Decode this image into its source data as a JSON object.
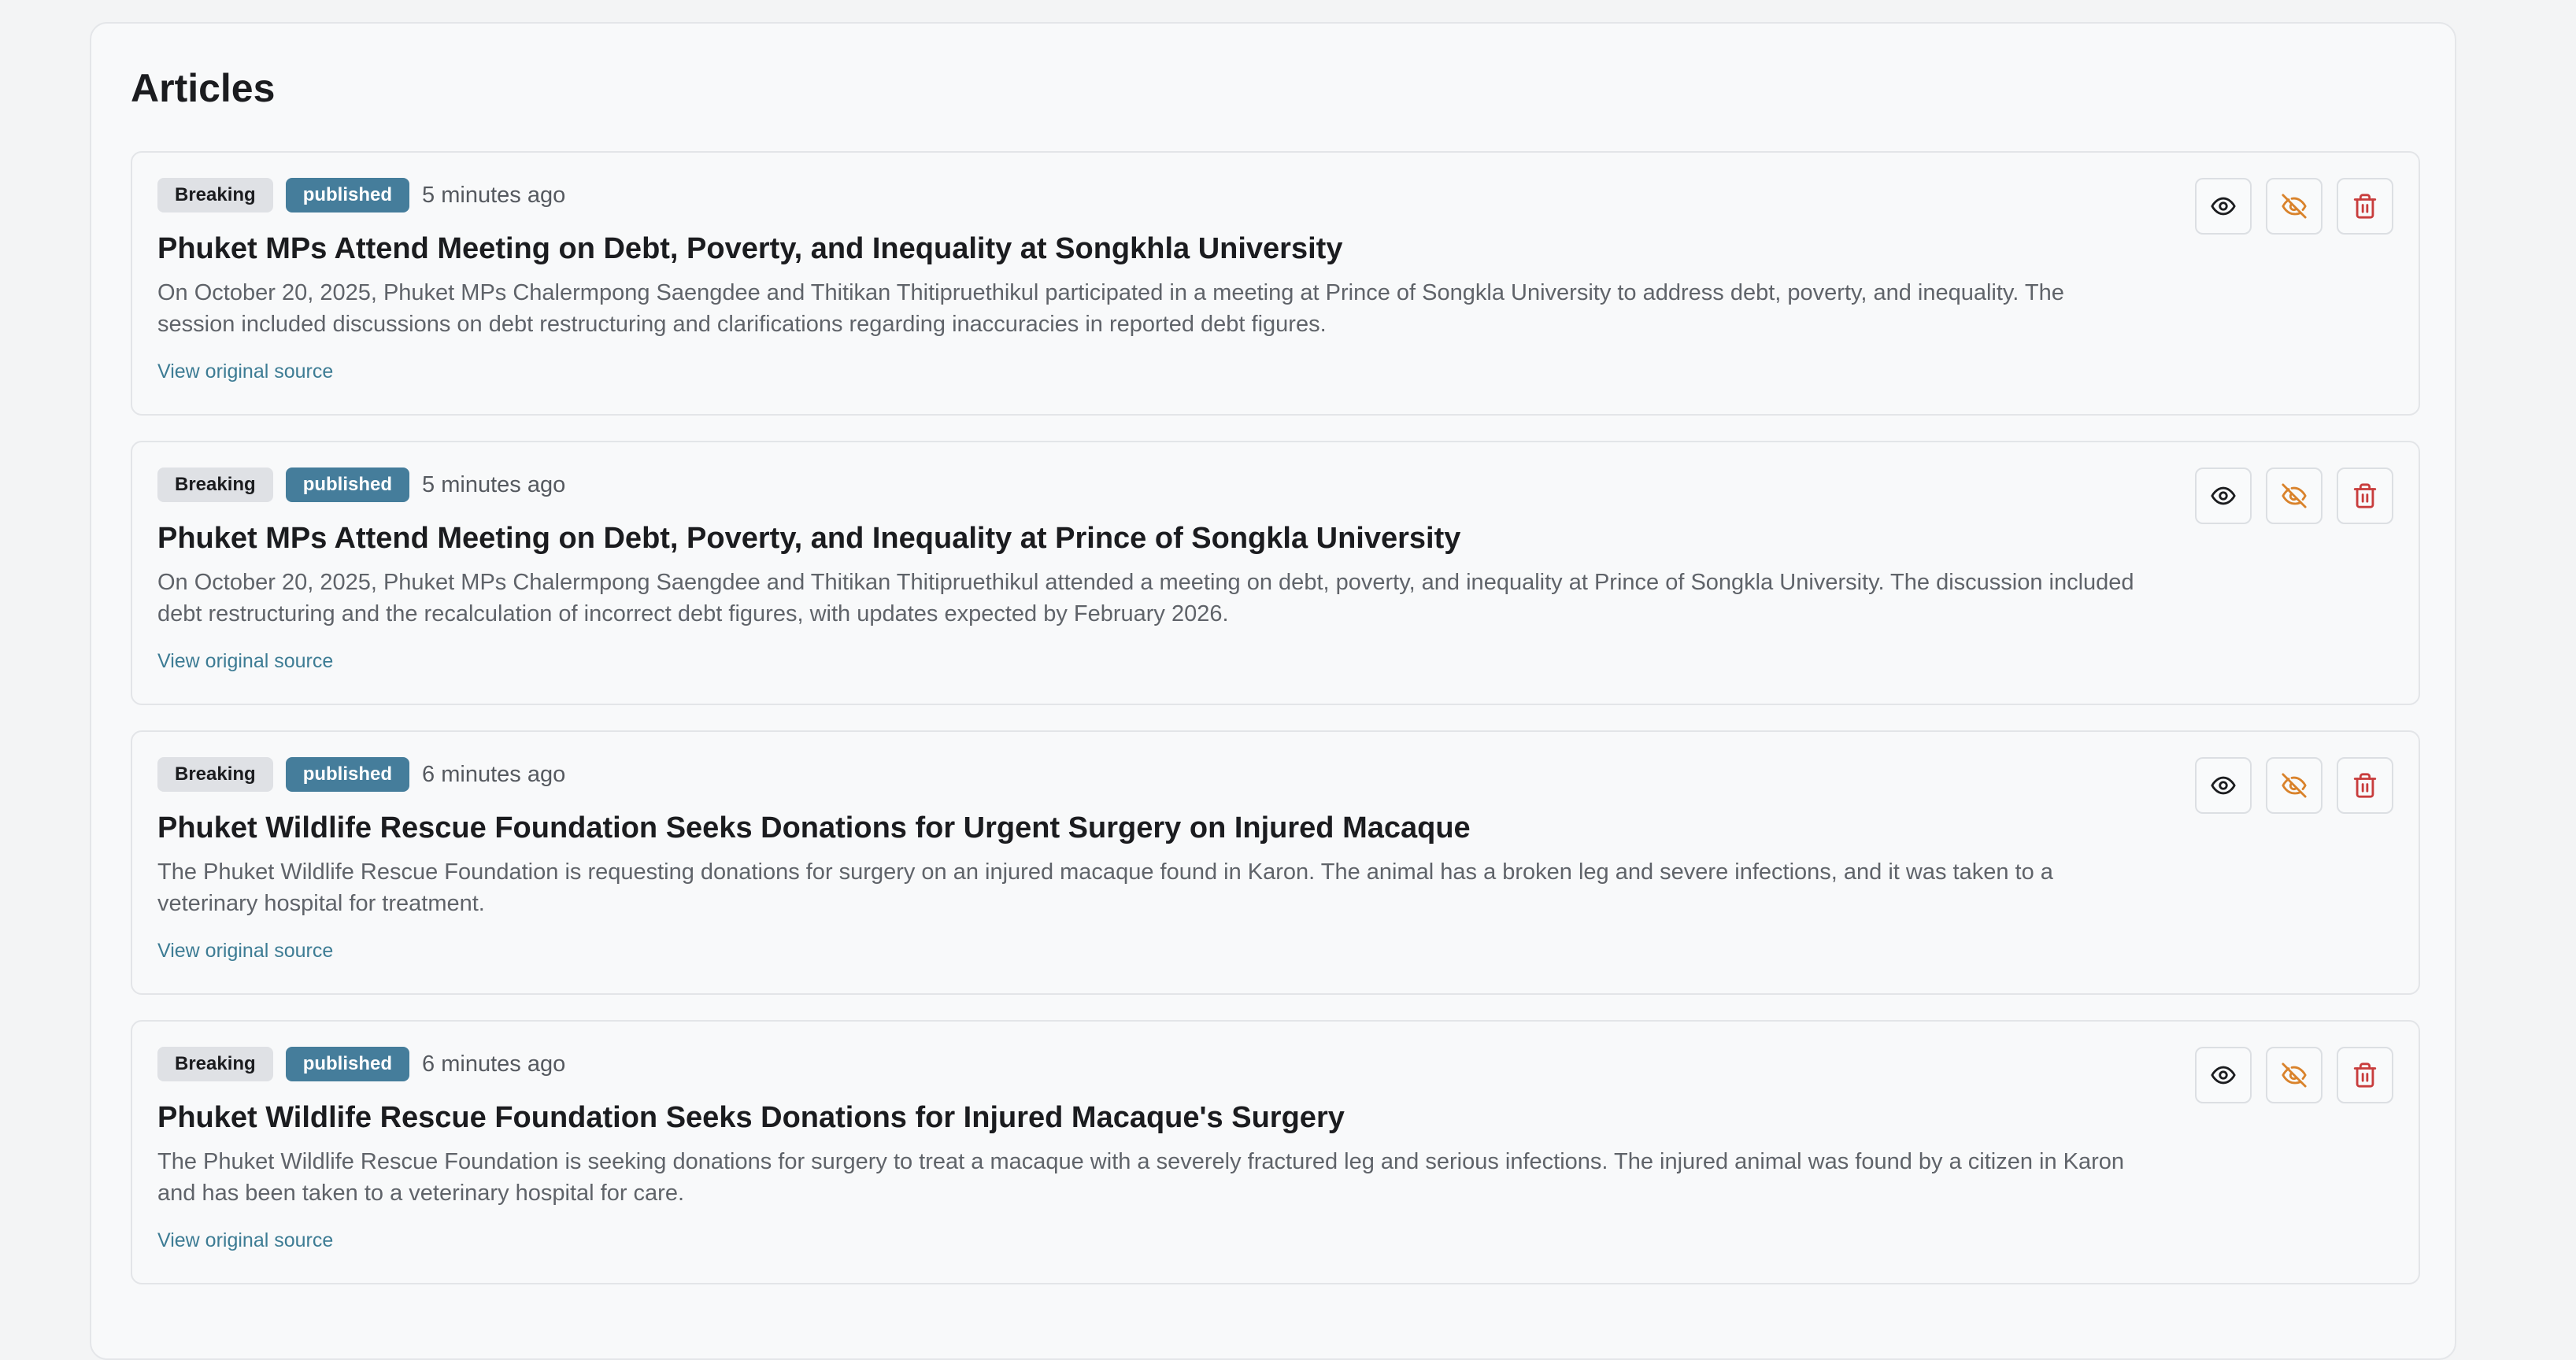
{
  "page": {
    "title": "Articles"
  },
  "colors": {
    "status_published": "#457d9b",
    "hide_action": "#d9822b",
    "delete_action": "#c83c3c",
    "link": "#3d7c94"
  },
  "actions": {
    "view_icon": "eye-icon",
    "hide_icon": "eye-off-icon",
    "delete_icon": "trash-icon"
  },
  "articles": [
    {
      "category": "Breaking",
      "status": "published",
      "time": "5 minutes ago",
      "title": "Phuket MPs Attend Meeting on Debt, Poverty, and Inequality at Songkhla University",
      "summary": "On October 20, 2025, Phuket MPs Chalermpong Saengdee and Thitikan Thitipruethikul participated in a meeting at Prince of Songkla University to address debt, poverty, and inequality. The session included discussions on debt restructuring and clarifications regarding inaccuracies in reported debt figures.",
      "link_text": "View original source"
    },
    {
      "category": "Breaking",
      "status": "published",
      "time": "5 minutes ago",
      "title": "Phuket MPs Attend Meeting on Debt, Poverty, and Inequality at Prince of Songkla University",
      "summary": "On October 20, 2025, Phuket MPs Chalermpong Saengdee and Thitikan Thitipruethikul attended a meeting on debt, poverty, and inequality at Prince of Songkla University. The discussion included debt restructuring and the recalculation of incorrect debt figures, with updates expected by February 2026.",
      "link_text": "View original source"
    },
    {
      "category": "Breaking",
      "status": "published",
      "time": "6 minutes ago",
      "title": "Phuket Wildlife Rescue Foundation Seeks Donations for Urgent Surgery on Injured Macaque",
      "summary": "The Phuket Wildlife Rescue Foundation is requesting donations for surgery on an injured macaque found in Karon. The animal has a broken leg and severe infections, and it was taken to a veterinary hospital for treatment.",
      "link_text": "View original source"
    },
    {
      "category": "Breaking",
      "status": "published",
      "time": "6 minutes ago",
      "title": "Phuket Wildlife Rescue Foundation Seeks Donations for Injured Macaque's Surgery",
      "summary": "The Phuket Wildlife Rescue Foundation is seeking donations for surgery to treat a macaque with a severely fractured leg and serious infections. The injured animal was found by a citizen in Karon and has been taken to a veterinary hospital for care.",
      "link_text": "View original source"
    }
  ]
}
